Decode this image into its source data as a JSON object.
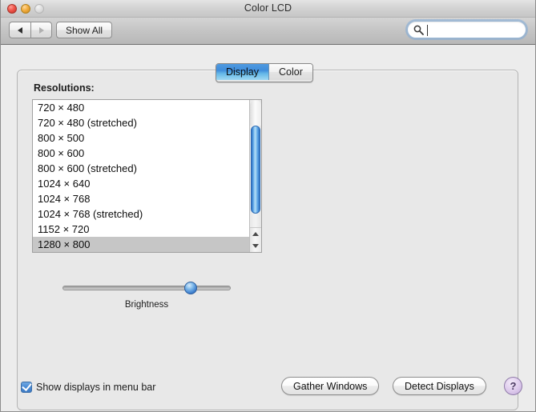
{
  "window": {
    "title": "Color LCD",
    "traffic_lights": [
      "close",
      "minimize",
      "zoom"
    ]
  },
  "toolbar": {
    "back_label": "◀",
    "forward_label": "▶",
    "show_all_label": "Show All",
    "search": {
      "value": "",
      "placeholder": "",
      "icon": "search-icon"
    }
  },
  "tabs": [
    {
      "label": "Display",
      "active": true
    },
    {
      "label": "Color",
      "active": false
    }
  ],
  "main": {
    "resolutions_label": "Resolutions:",
    "resolutions": [
      {
        "label": "720 × 480",
        "selected": false
      },
      {
        "label": "720 × 480 (stretched)",
        "selected": false
      },
      {
        "label": "800 × 500",
        "selected": false
      },
      {
        "label": "800 × 600",
        "selected": false
      },
      {
        "label": "800 × 600 (stretched)",
        "selected": false
      },
      {
        "label": "1024 × 640",
        "selected": false
      },
      {
        "label": "1024 × 768",
        "selected": false
      },
      {
        "label": "1024 × 768 (stretched)",
        "selected": false
      },
      {
        "label": "1152 × 720",
        "selected": false
      },
      {
        "label": "1280 × 800",
        "selected": true
      }
    ],
    "brightness": {
      "label": "Brightness",
      "value_percent": 73
    }
  },
  "footer": {
    "show_displays_label": "Show displays in menu bar",
    "show_displays_checked": true,
    "gather_windows_label": "Gather Windows",
    "detect_displays_label": "Detect Displays",
    "help_label": "?"
  },
  "colors": {
    "accent_blue": "#4f9ae0",
    "window_bg": "#ececec",
    "selection_gray": "#c6c6c6",
    "help_purple": "#c3abda"
  }
}
